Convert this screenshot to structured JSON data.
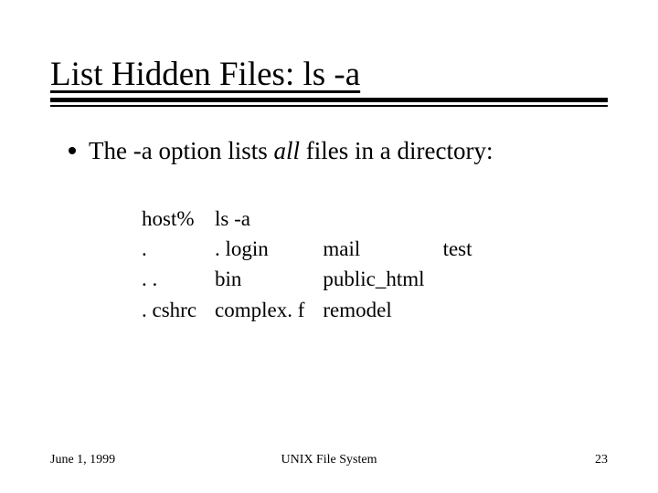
{
  "title": "List Hidden Files:  ls -a",
  "bullet": {
    "prefix": "The ",
    "opt": "-a",
    "mid": " option lists ",
    "em": "all",
    "suffix": " files in a directory:"
  },
  "terminal": {
    "row0": {
      "c1": "host%",
      "c2": "ls  -a",
      "c3": "",
      "c4": ""
    },
    "row1": {
      "c1": ".",
      "c2": ". login",
      "c3": "mail",
      "c4": "test"
    },
    "row2": {
      "c1": ". .",
      "c2": "bin",
      "c3": "public_html",
      "c4": ""
    },
    "row3": {
      "c1": ". cshrc",
      "c2": "complex. f",
      "c3": "remodel",
      "c4": ""
    }
  },
  "footer": {
    "date": "June 1, 1999",
    "center": "UNIX File System",
    "page": "23"
  }
}
